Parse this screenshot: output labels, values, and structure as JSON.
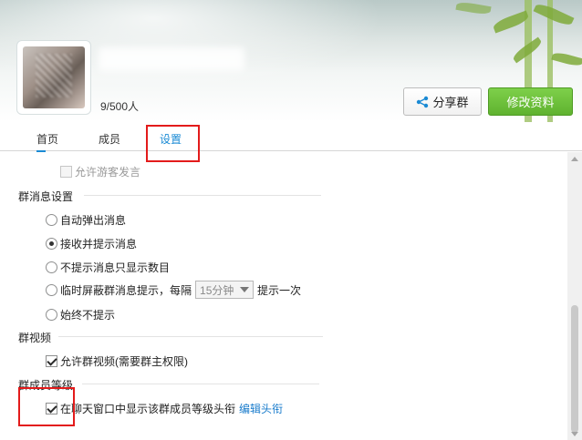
{
  "header": {
    "member_count": "9/500人",
    "share_label": "分享群",
    "edit_label": "修改资料"
  },
  "tabs": [
    {
      "label": "首页"
    },
    {
      "label": "成员"
    },
    {
      "label": "设置"
    }
  ],
  "colors": {
    "accent": "#1a8ad4",
    "edit_button": "#5fb22f",
    "highlight": "#e31b1b"
  },
  "settings": {
    "allow_guest_speak": {
      "label": "允许游客发言",
      "checked": false,
      "disabled": true
    },
    "message_section": {
      "title": "群消息设置",
      "options": [
        {
          "label": "自动弹出消息",
          "selected": false
        },
        {
          "label": "接收并提示消息",
          "selected": true
        },
        {
          "label": "不提示消息只显示数目",
          "selected": false
        },
        {
          "label": "临时屏蔽群消息提示，每隔",
          "selected": false
        },
        {
          "label": "始终不提示",
          "selected": false
        }
      ],
      "interval_select": "15分钟",
      "interval_suffix": "提示一次"
    },
    "video_section": {
      "title": "群视频",
      "allow_video": {
        "label": "允许群视频(需要群主权限)",
        "checked": true
      }
    },
    "level_section": {
      "title": "群成员等级",
      "show_level": {
        "label": "在聊天窗口中显示该群成员等级头衔",
        "checked": true
      },
      "edit_link": "编辑头衔"
    }
  }
}
